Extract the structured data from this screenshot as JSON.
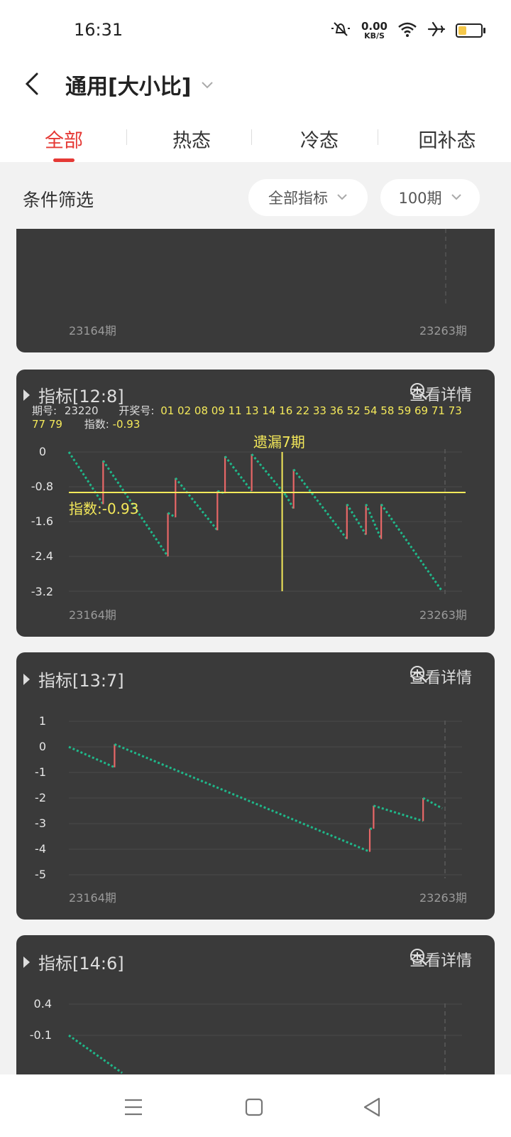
{
  "status": {
    "time": "16:31",
    "net_speed": "0.00",
    "net_unit": "KB/S",
    "battery_level": 0.35,
    "icons": [
      "mute-icon",
      "wifi-icon",
      "airplane-icon",
      "battery-icon"
    ]
  },
  "header": {
    "title": "通用[大小比]",
    "tabs": [
      {
        "label": "全部",
        "active": true
      },
      {
        "label": "热态",
        "active": false
      },
      {
        "label": "冷态",
        "active": false
      },
      {
        "label": "回补态",
        "active": false
      }
    ]
  },
  "filters": {
    "label": "条件筛选",
    "indicator_select": "全部指标",
    "period_select": "100期"
  },
  "colors": {
    "accent": "#e53935",
    "card_bg": "#3a3a3a",
    "up": "#e86767",
    "down": "#1fb88a",
    "crosshair": "#f4e95a"
  },
  "cards": [
    {
      "x_start": "23164期",
      "x_end": "23263期"
    },
    {
      "title": "指标[12:8]",
      "detail_label": "查看详情",
      "info": {
        "period_label": "期号:",
        "period_value": "23220",
        "draw_label": "开奖号:",
        "draw_numbers_line1": "01 02 08 09 11 13 14 16 22 33 36 52 54 58 59 69 71 73",
        "draw_numbers_line2": "77 79",
        "index_label": "指数:",
        "index_value": "-0.93"
      },
      "missing_label": "遗漏7期",
      "index_tag": "指数:-0.93",
      "x_start": "23164期",
      "x_end": "23263期",
      "yticks": [
        "0",
        "-0.8",
        "-1.6",
        "-2.4",
        "-3.2"
      ]
    },
    {
      "title": "指标[13:7]",
      "detail_label": "查看详情",
      "x_start": "23164期",
      "x_end": "23263期",
      "yticks": [
        "1",
        "0",
        "-1",
        "-2",
        "-3",
        "-4",
        "-5"
      ]
    },
    {
      "title": "指标[14:6]",
      "detail_label": "查看详情",
      "yticks": [
        "0.4",
        "-0.1"
      ]
    }
  ],
  "chart_data": [
    {
      "type": "line",
      "title": "指标[12:8]",
      "x": [
        "23164期",
        "23263期"
      ],
      "ylim": [
        -3.2,
        0
      ],
      "crosshair": {
        "x": "23220",
        "y": -0.93
      },
      "points": [
        [
          0,
          0
        ],
        [
          9,
          -1.2
        ],
        [
          9,
          -0.2
        ],
        [
          26,
          -2.4
        ],
        [
          26,
          -1.4
        ],
        [
          28,
          -1.5
        ],
        [
          28,
          -0.6
        ],
        [
          39,
          -1.8
        ],
        [
          39,
          -0.9
        ],
        [
          41,
          -0.95
        ],
        [
          41,
          -0.1
        ],
        [
          48,
          -0.9
        ],
        [
          48,
          -0.05
        ],
        [
          57,
          -1.0
        ],
        [
          59,
          -1.3
        ],
        [
          59,
          -0.4
        ],
        [
          73,
          -2.0
        ],
        [
          73,
          -1.2
        ],
        [
          78,
          -1.9
        ],
        [
          78,
          -1.2
        ],
        [
          82,
          -2.0
        ],
        [
          82,
          -1.2
        ],
        [
          98,
          -3.2
        ]
      ]
    },
    {
      "type": "line",
      "title": "指标[13:7]",
      "x": [
        "23164期",
        "23263期"
      ],
      "ylim": [
        -5,
        1
      ],
      "points": [
        [
          0,
          0
        ],
        [
          12,
          -0.8
        ],
        [
          12,
          0.1
        ],
        [
          79,
          -4.1
        ],
        [
          79,
          -3.2
        ],
        [
          80,
          -3.2
        ],
        [
          80,
          -2.3
        ],
        [
          93,
          -2.9
        ],
        [
          93,
          -2.0
        ],
        [
          98,
          -2.4
        ]
      ]
    },
    {
      "type": "line",
      "title": "指标[14:6]",
      "ylim": [
        -0.1,
        0.4
      ],
      "points": [
        [
          0,
          -0.1
        ],
        [
          14,
          -0.7
        ]
      ]
    }
  ]
}
